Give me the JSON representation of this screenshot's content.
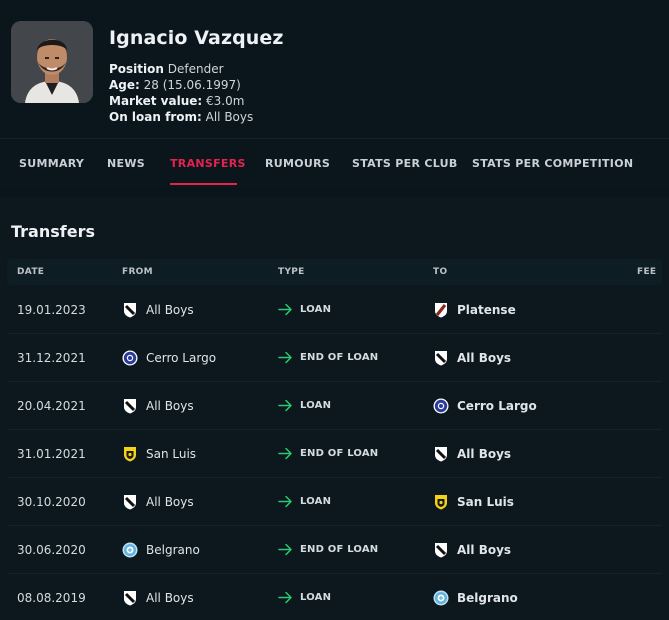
{
  "player": {
    "name": "Ignacio Vazquez",
    "position_label": "Position",
    "position": "Defender",
    "age_label": "Age:",
    "age": "28 (15.06.1997)",
    "market_value_label": "Market value:",
    "market_value": "€3.0m",
    "loan_label": "On loan from:",
    "loan_from": "All Boys"
  },
  "tabs": [
    {
      "label": "SUMMARY"
    },
    {
      "label": "NEWS"
    },
    {
      "label": "TRANSFERS",
      "active": true
    },
    {
      "label": "RUMOURS"
    },
    {
      "label": "STATS PER CLUB"
    },
    {
      "label": "STATS PER COMPETITION"
    }
  ],
  "transfers": {
    "title": "Transfers",
    "columns": {
      "date": "DATE",
      "from": "FROM",
      "type": "TYPE",
      "to": "TO",
      "fee": "FEE"
    },
    "rows": [
      {
        "date": "19.01.2023",
        "from": "All Boys",
        "from_crest": "all-boys",
        "type": "LOAN",
        "to": "Platense",
        "to_crest": "platense",
        "fee": ""
      },
      {
        "date": "31.12.2021",
        "from": "Cerro Largo",
        "from_crest": "cerro-largo",
        "type": "END OF LOAN",
        "to": "All Boys",
        "to_crest": "all-boys",
        "fee": ""
      },
      {
        "date": "20.04.2021",
        "from": "All Boys",
        "from_crest": "all-boys",
        "type": "LOAN",
        "to": "Cerro Largo",
        "to_crest": "cerro-largo",
        "fee": ""
      },
      {
        "date": "31.01.2021",
        "from": "San Luis",
        "from_crest": "san-luis",
        "type": "END OF LOAN",
        "to": "All Boys",
        "to_crest": "all-boys",
        "fee": ""
      },
      {
        "date": "30.10.2020",
        "from": "All Boys",
        "from_crest": "all-boys",
        "type": "LOAN",
        "to": "San Luis",
        "to_crest": "san-luis",
        "fee": ""
      },
      {
        "date": "30.06.2020",
        "from": "Belgrano",
        "from_crest": "belgrano",
        "type": "END OF LOAN",
        "to": "All Boys",
        "to_crest": "all-boys",
        "fee": ""
      },
      {
        "date": "08.08.2019",
        "from": "All Boys",
        "from_crest": "all-boys",
        "type": "LOAN",
        "to": "Belgrano",
        "to_crest": "belgrano",
        "fee": ""
      }
    ]
  },
  "colors": {
    "accent": "#e4234f",
    "arrow": "#2fc76a",
    "background": "#0a141b"
  }
}
